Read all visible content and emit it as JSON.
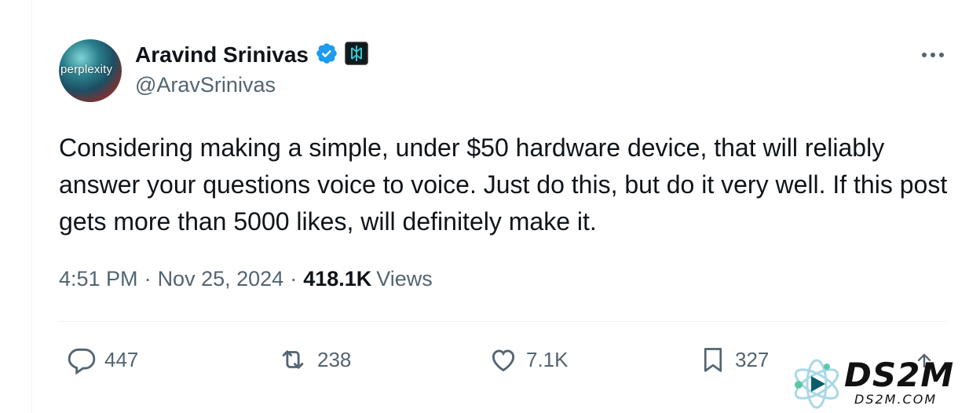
{
  "author": {
    "display_name": "Aravind Srinivas",
    "handle": "@AravSrinivas",
    "avatar_text": "perplexity",
    "verified": true,
    "affiliate_badge": "perplexity-badge"
  },
  "tweet": {
    "text": "Considering making a simple, under $50 hardware device, that will reliably answer your questions voice to voice. Just do this, but do it very well. If this post gets more than 5000 likes, will definitely make it.",
    "time": "4:51 PM",
    "separator": "·",
    "date": "Nov 25, 2024",
    "views_count": "418.1K",
    "views_label": "Views"
  },
  "actions": {
    "replies": "447",
    "reposts": "238",
    "likes": "7.1K",
    "bookmarks": "327"
  },
  "more_label": "•••",
  "watermark": {
    "text": "DS2M",
    "subtext": "DS2M.COM"
  },
  "colors": {
    "text_primary": "#0f1419",
    "text_secondary": "#536471",
    "verified_blue": "#1d9bf0",
    "divider": "#eff3f4"
  }
}
